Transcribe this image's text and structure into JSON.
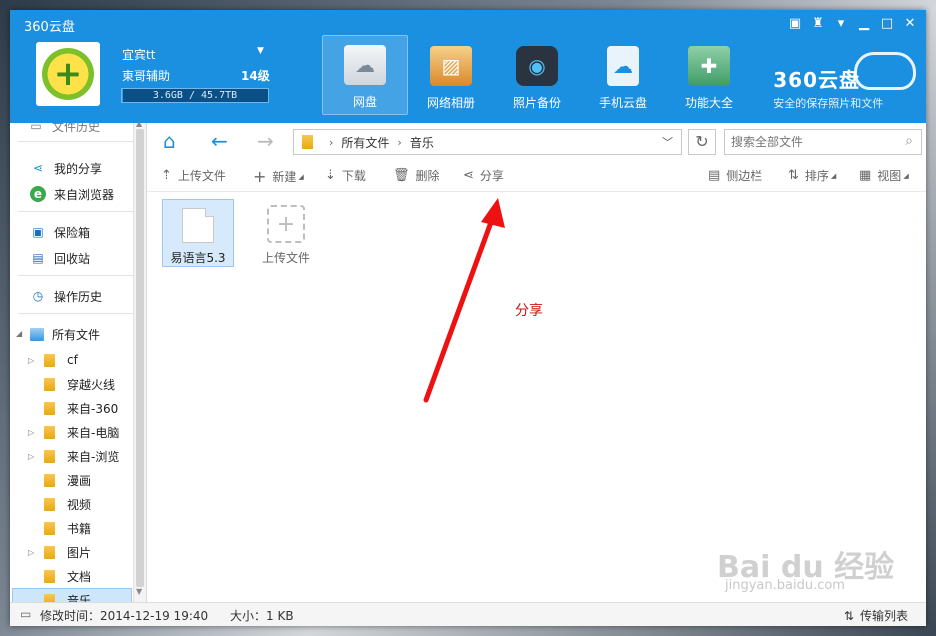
{
  "window": {
    "title": "360云盘"
  },
  "window_controls": [
    "feedback-icon",
    "skin-icon",
    "menu-icon",
    "minimize-icon",
    "maximize-icon",
    "close-icon"
  ],
  "user": {
    "name": "宜宾tt",
    "tag": "東哥辅助",
    "level": "14级",
    "quota_text": "3.6GB / 45.7TB",
    "quota_fraction": 0.0001
  },
  "nav": [
    {
      "label": "网盘",
      "icon": "cloud-drive-icon",
      "active": true
    },
    {
      "label": "网络相册",
      "icon": "photo-album-icon",
      "active": false
    },
    {
      "label": "照片备份",
      "icon": "camera-icon",
      "active": false
    },
    {
      "label": "手机云盘",
      "icon": "phone-cloud-icon",
      "active": false
    },
    {
      "label": "功能大全",
      "icon": "tools-icon",
      "active": false
    }
  ],
  "brand": {
    "name": "360云盘",
    "slogan": "安全的保存照片和文件"
  },
  "sidebar": {
    "top_cut": "文件历史",
    "items": [
      {
        "label": "我的分享",
        "icon": "share-icon"
      },
      {
        "label": "来自浏览器",
        "icon": "browser-icon"
      },
      {
        "label": "保险箱",
        "icon": "safe-icon"
      },
      {
        "label": "回收站",
        "icon": "recycle-bin-icon"
      },
      {
        "label": "操作历史",
        "icon": "history-icon"
      }
    ],
    "root": "所有文件",
    "folders": [
      "cf",
      "穿越火线",
      "来自-360",
      "来自-电脑",
      "来自-浏览",
      "漫画",
      "视频",
      "书籍",
      "图片",
      "文档",
      "音乐"
    ],
    "selected": "音乐"
  },
  "path": {
    "root": "所有文件",
    "current": "音乐"
  },
  "search": {
    "placeholder": "搜索全部文件"
  },
  "actions": {
    "upload": "上传文件",
    "new": "新建",
    "download": "下载",
    "delete": "删除",
    "share": "分享",
    "sidebar": "侧边栏",
    "sort": "排序",
    "view": "视图"
  },
  "files": [
    {
      "name": "易语言5.3"
    }
  ],
  "upload_tile": {
    "label": "上传文件"
  },
  "annotation": "分享",
  "watermark": {
    "main": "Bai du 经验",
    "sub": "jingyan.baidu.com"
  },
  "status": {
    "modified": "修改时间：2014-12-19 19:40",
    "size": "大小：1 KB",
    "transfer": "传输列表"
  },
  "colors": {
    "header": "#1b8fe0",
    "annotation": "#d01010",
    "selection": "#cde6fb"
  }
}
